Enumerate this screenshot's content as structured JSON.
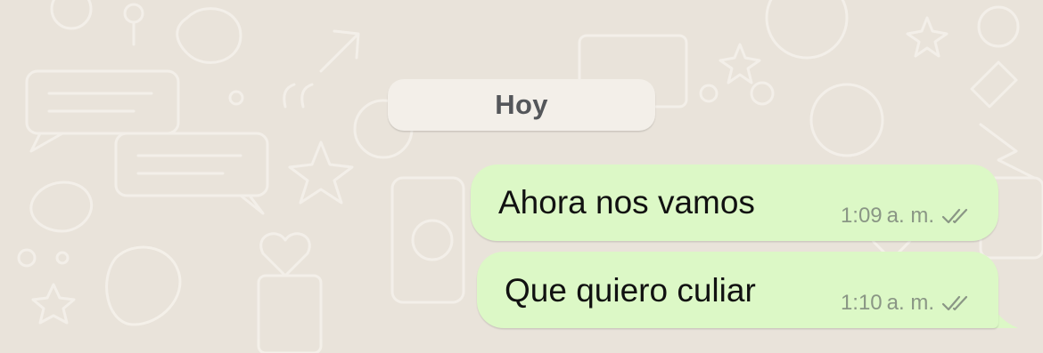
{
  "chat": {
    "date_separator": "Hoy",
    "messages": [
      {
        "text": "Ahora nos vamos",
        "time": "1:09",
        "ampm": "a. m.",
        "status_icon": "double-check-icon"
      },
      {
        "text": "Que quiero culiar",
        "time": "1:10",
        "ampm": "a. m.",
        "status_icon": "double-check-icon"
      }
    ]
  },
  "colors": {
    "wallpaper": "#e9e3da",
    "wallpaper_doodles": "#f4f0ea",
    "outgoing_bubble": "#dcf8c6",
    "date_chip": "#f3efe9",
    "date_text": "#54565a",
    "message_text": "#111111",
    "meta_text": "#8a9685"
  }
}
